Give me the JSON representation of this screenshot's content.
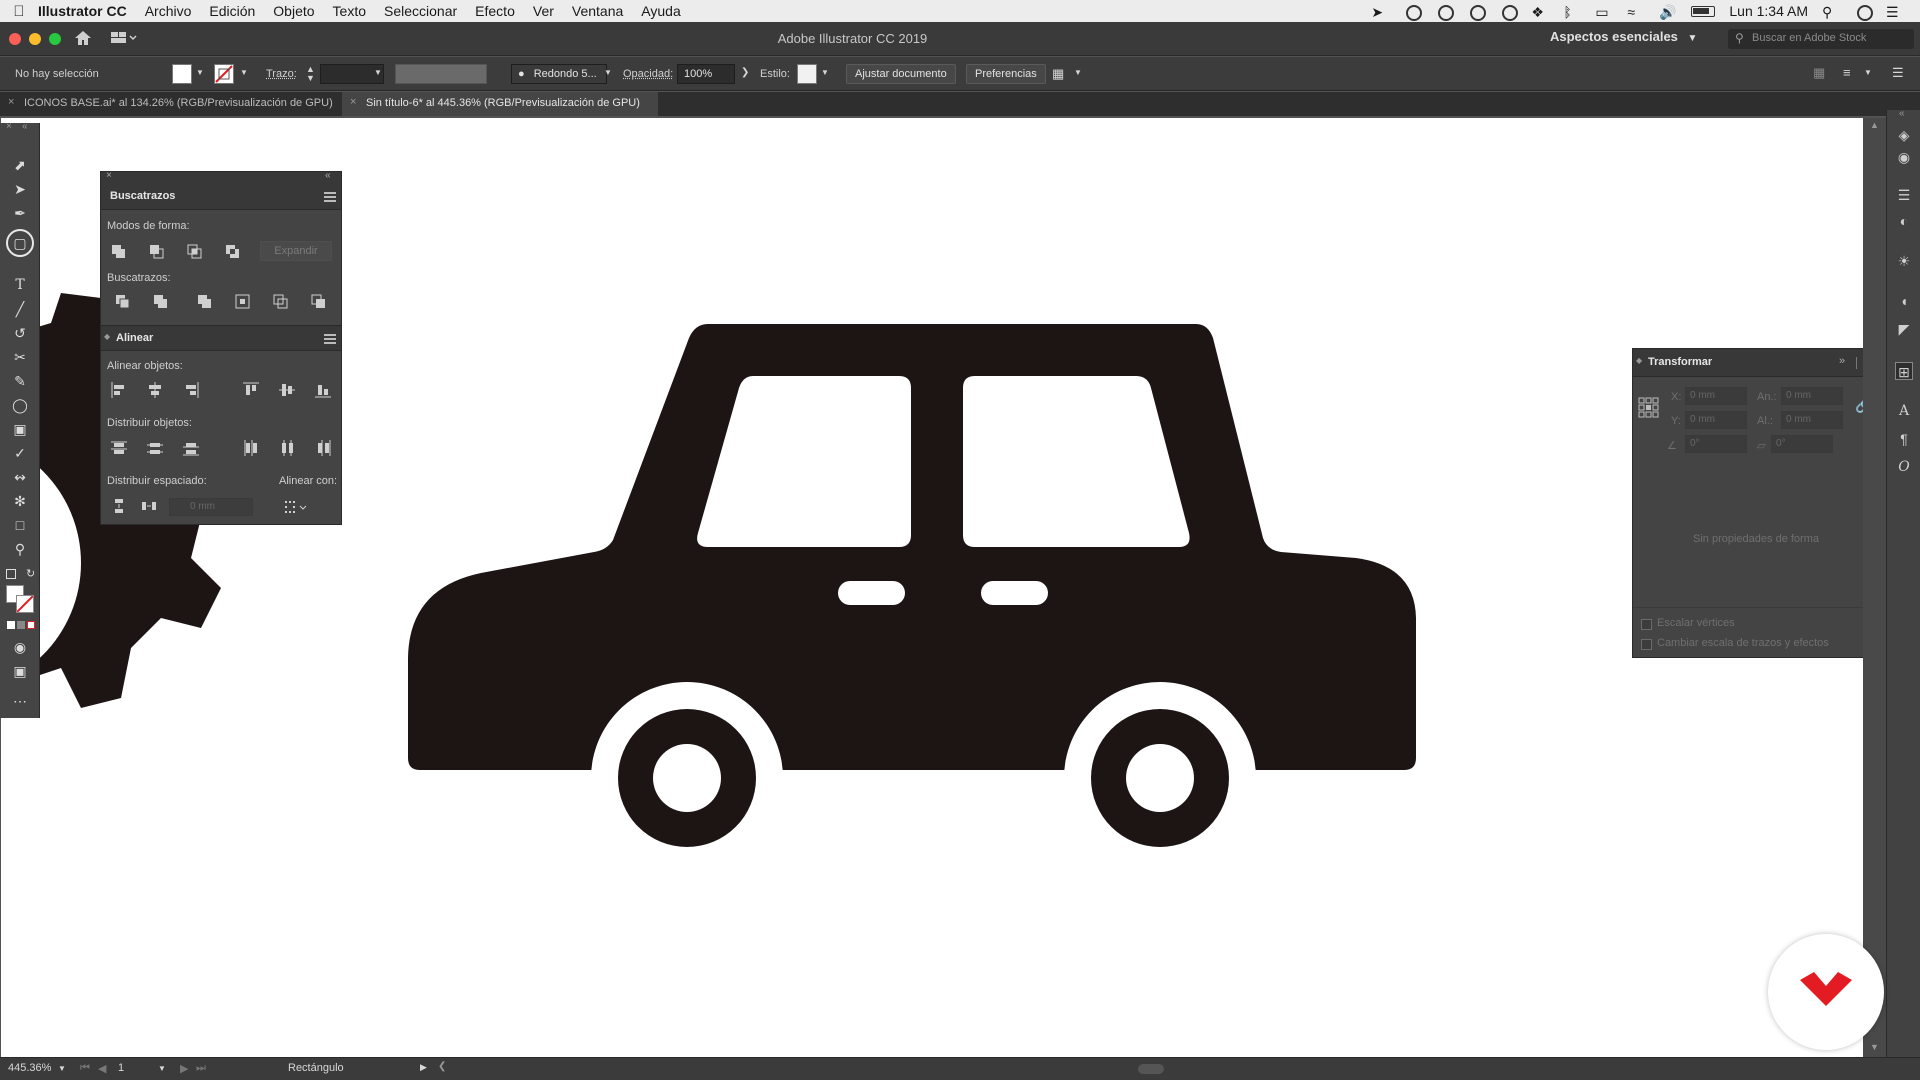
{
  "menubar": {
    "app_name": "Illustrator CC",
    "items": [
      "Archivo",
      "Edición",
      "Objeto",
      "Texto",
      "Seleccionar",
      "Efecto",
      "Ver",
      "Ventana",
      "Ayuda"
    ],
    "clock": "Lun 1:34 AM"
  },
  "titlebar": {
    "title": "Adobe Illustrator CC 2019",
    "workspace": "Aspectos esenciales",
    "search_placeholder": "Buscar en Adobe Stock"
  },
  "control": {
    "selection": "No hay selección",
    "stroke_label": "Trazo:",
    "brush": "Redondo 5...",
    "opacity_label": "Opacidad:",
    "opacity_value": "100%",
    "style_label": "Estilo:",
    "adjust_button": "Ajustar documento",
    "prefs_button": "Preferencias"
  },
  "tabs": [
    {
      "label": "ICONOS BASE.ai* al 134.26% (RGB/Previsualización de GPU)",
      "active": false
    },
    {
      "label": "Sin título-6* al 445.36% (RGB/Previsualización de GPU)",
      "active": true
    }
  ],
  "pathfinder": {
    "title": "Buscatrazos",
    "shape_modes": "Modos de forma:",
    "expand": "Expandir",
    "pathfinders": "Buscatrazos:"
  },
  "align": {
    "title": "Alinear",
    "align_objects": "Alinear objetos:",
    "distribute_objects": "Distribuir objetos:",
    "distribute_spacing": "Distribuir espaciado:",
    "align_to": "Alinear con:",
    "spacing_value": "0 mm"
  },
  "transform": {
    "title": "Transformar",
    "x_label": "X:",
    "x_value": "0 mm",
    "y_label": "Y:",
    "y_value": "0 mm",
    "w_label": "An.:",
    "w_value": "0 mm",
    "h_label": "Al.:",
    "h_value": "0 mm",
    "angle_value": "0°",
    "shear_value": "0°",
    "empty_message": "Sin propiedades de forma",
    "scale_corners": "Escalar vértices",
    "scale_strokes": "Cambiar escala de trazos y efectos"
  },
  "status": {
    "zoom": "445.36%",
    "artboard": "1",
    "tool": "Rectángulo"
  },
  "colors": {
    "artwork": "#1d1513",
    "logo": "#e31b23",
    "accent": "#d6d6d6"
  }
}
